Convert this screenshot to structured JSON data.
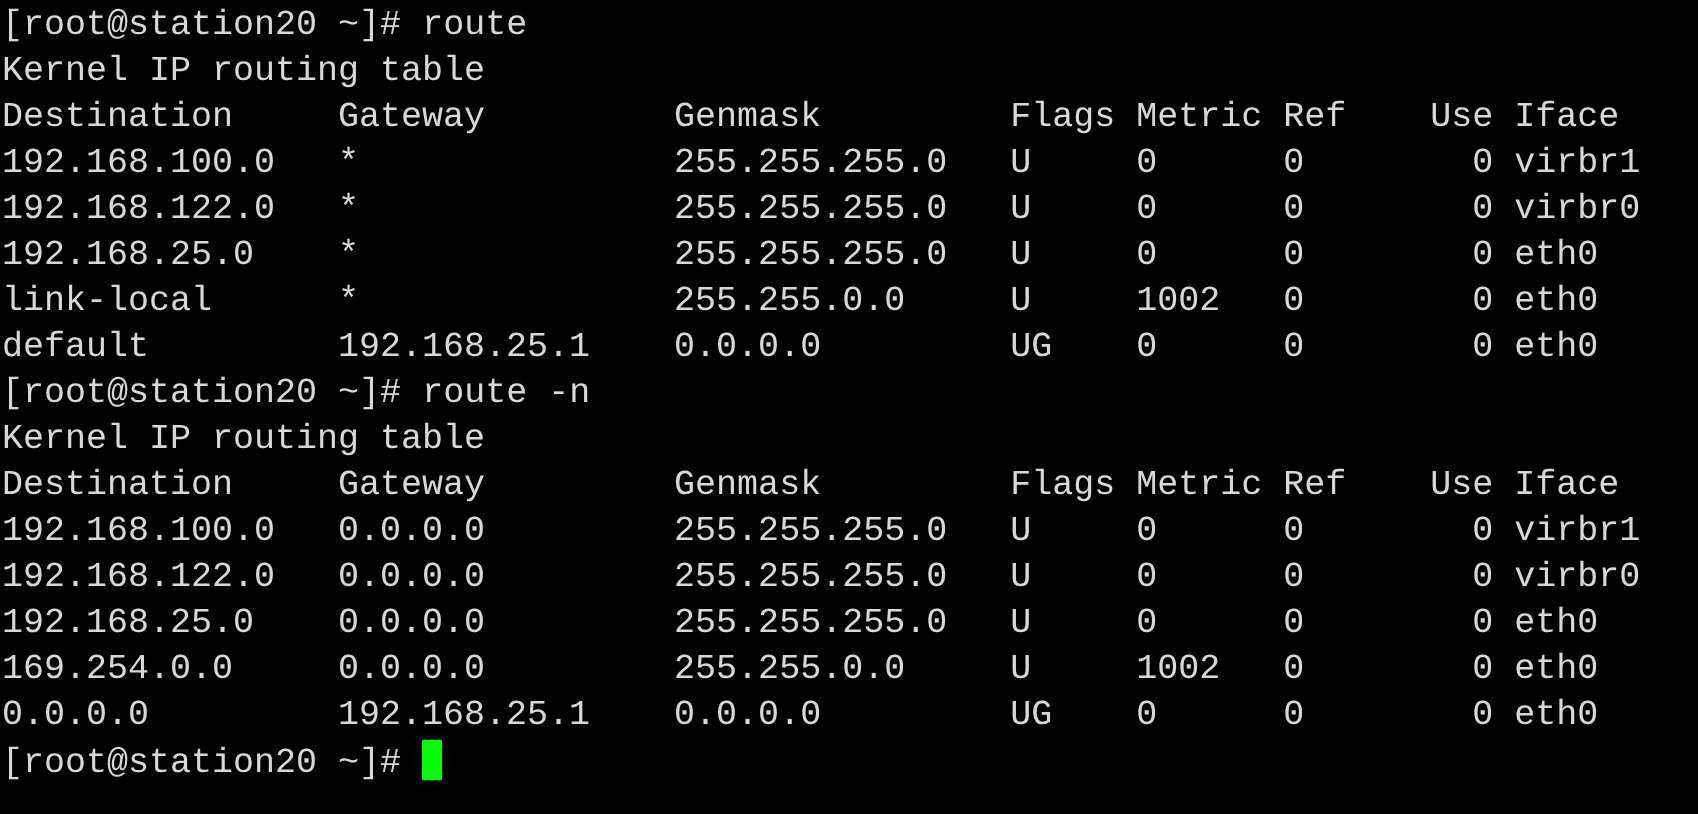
{
  "terminal": {
    "lines": [
      {
        "kind": "prompt",
        "prompt": "[root@station20 ~]#",
        "command": "route"
      },
      {
        "kind": "output",
        "text": "Kernel IP routing table"
      },
      {
        "kind": "output",
        "text": "Destination     Gateway         Genmask         Flags Metric Ref    Use Iface"
      },
      {
        "kind": "output",
        "text": "192.168.100.0   *               255.255.255.0   U     0      0        0 virbr1"
      },
      {
        "kind": "output",
        "text": "192.168.122.0   *               255.255.255.0   U     0      0        0 virbr0"
      },
      {
        "kind": "output",
        "text": "192.168.25.0    *               255.255.255.0   U     0      0        0 eth0"
      },
      {
        "kind": "output",
        "text": "link-local      *               255.255.0.0     U     1002   0        0 eth0"
      },
      {
        "kind": "output",
        "text": "default         192.168.25.1    0.0.0.0         UG    0      0        0 eth0"
      },
      {
        "kind": "prompt",
        "prompt": "[root@station20 ~]#",
        "command": "route -n"
      },
      {
        "kind": "output",
        "text": "Kernel IP routing table"
      },
      {
        "kind": "output",
        "text": "Destination     Gateway         Genmask         Flags Metric Ref    Use Iface"
      },
      {
        "kind": "output",
        "text": "192.168.100.0   0.0.0.0         255.255.255.0   U     0      0        0 virbr1"
      },
      {
        "kind": "output",
        "text": "192.168.122.0   0.0.0.0         255.255.255.0   U     0      0        0 virbr0"
      },
      {
        "kind": "output",
        "text": "192.168.25.0    0.0.0.0         255.255.255.0   U     0      0        0 eth0"
      },
      {
        "kind": "output",
        "text": "169.254.0.0     0.0.0.0         255.255.0.0     U     1002   0        0 eth0"
      },
      {
        "kind": "output",
        "text": "0.0.0.0         192.168.25.1    0.0.0.0         UG    0      0        0 eth0"
      },
      {
        "kind": "prompt",
        "prompt": "[root@station20 ~]#",
        "cursor": true
      }
    ]
  }
}
